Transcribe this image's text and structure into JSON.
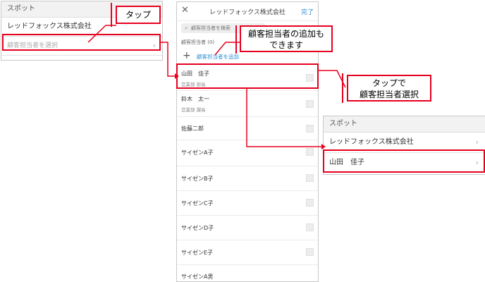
{
  "left_panel": {
    "header": "スポット",
    "company": "レッドフォックス株式会社",
    "select_placeholder": "顧客担当者を選択"
  },
  "phone": {
    "title": "レッドフォックス株式会社",
    "done": "完了",
    "search_placeholder": "顧客担当者を検索",
    "assignee_count": "顧客担当者 (0)",
    "add_label": "顧客担当者を追加",
    "people": [
      {
        "name": "山田　佳子",
        "dept": "営業部 部長"
      },
      {
        "name": "鈴木　太一",
        "dept": "営業部 課長"
      },
      {
        "name": "佐藤二郎",
        "dept": ""
      },
      {
        "name": "サイゼンA子",
        "dept": ""
      },
      {
        "name": "サイゼンB子",
        "dept": ""
      },
      {
        "name": "サイゼンC子",
        "dept": ""
      },
      {
        "name": "サイゼンD子",
        "dept": ""
      },
      {
        "name": "サイゼンE子",
        "dept": ""
      },
      {
        "name": "サイゼンA男",
        "dept": ""
      }
    ]
  },
  "right_panel": {
    "header": "スポット",
    "company": "レッドフォックス株式会社",
    "selected": "山田　佳子"
  },
  "callouts": {
    "tap": "タップ",
    "add_note_line1": "顧客担当者の追加も",
    "add_note_line2": "できます",
    "tap_select_line1": "タップで",
    "tap_select_line2": "顧客担当者選択"
  },
  "colors": {
    "annotation_red": "#e6001f",
    "link_blue": "#2e8fd6"
  }
}
